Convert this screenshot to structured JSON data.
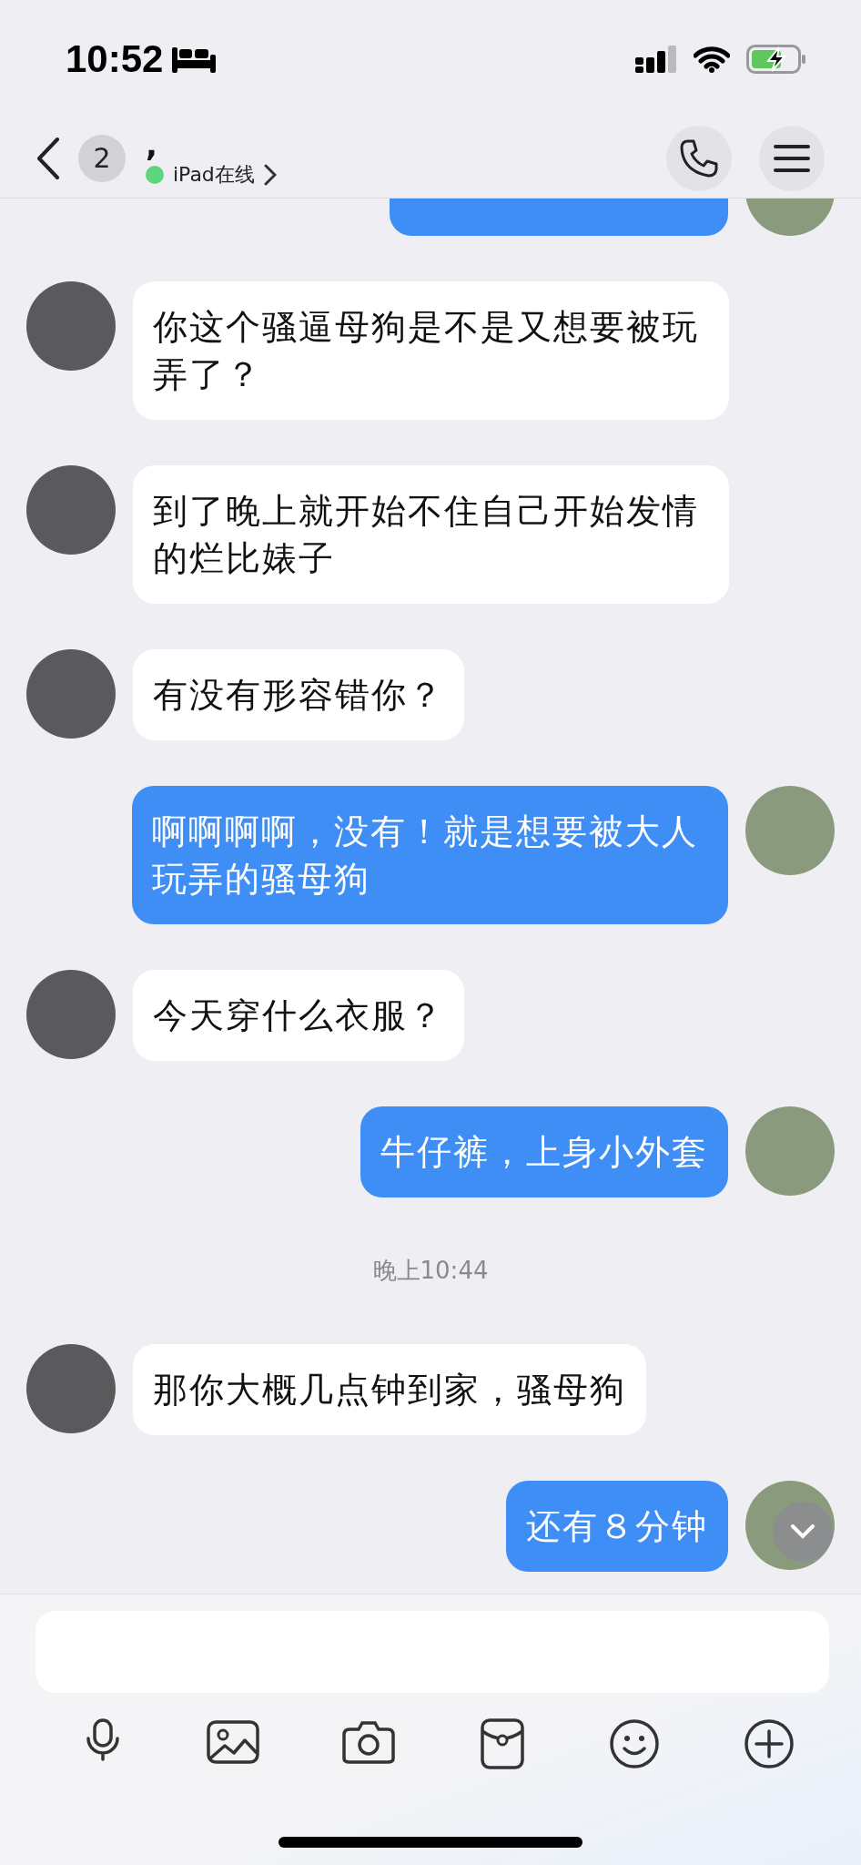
{
  "status_bar": {
    "time": "10:52"
  },
  "header": {
    "unread_count": "2",
    "contact_name": ",",
    "presence": {
      "label": "iPad在线",
      "online": true
    }
  },
  "messages": [
    {
      "kind": "sent_cut_off"
    },
    {
      "kind": "received",
      "text": "你这个骚逼母狗是不是又想要被玩弄了？"
    },
    {
      "kind": "received",
      "text": "到了晚上就开始不住自己开始发情的烂比婊子"
    },
    {
      "kind": "received",
      "text": "有没有形容错你？"
    },
    {
      "kind": "sent",
      "text": "啊啊啊啊，没有！就是想要被大人玩弄的骚母狗"
    },
    {
      "kind": "received",
      "text": "今天穿什么衣服？"
    },
    {
      "kind": "sent",
      "text": "牛仔裤，上身小外套"
    },
    {
      "kind": "time",
      "text": "晚上10:44"
    },
    {
      "kind": "received",
      "text": "那你大概几点钟到家，骚母狗"
    },
    {
      "kind": "sent",
      "text": "还有８分钟"
    }
  ]
}
